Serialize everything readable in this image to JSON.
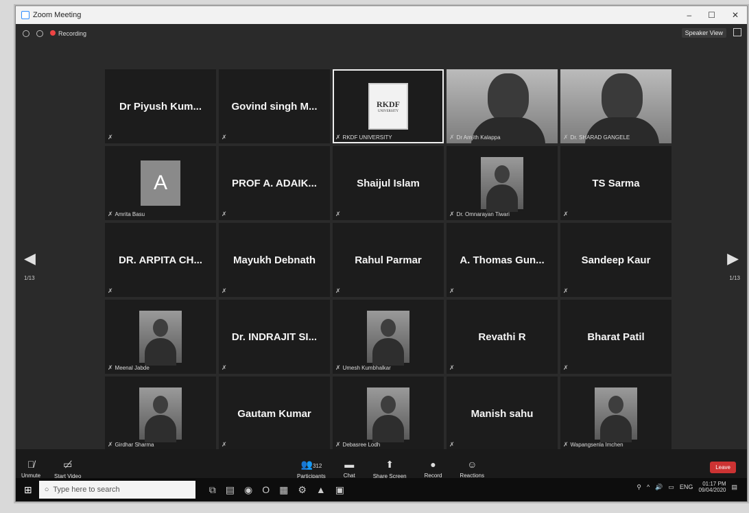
{
  "window": {
    "title": "Zoom Meeting",
    "controls": [
      "–",
      "☐",
      "✕"
    ]
  },
  "topbar": {
    "recording_label": "Recording",
    "speaker_view_label": "Speaker View"
  },
  "tiles": [
    {
      "name": "Dr Piyush  Kum...",
      "label": "",
      "type": "name"
    },
    {
      "name": "Govind singh M...",
      "label": "",
      "type": "name"
    },
    {
      "name": "",
      "label": "RKDF UNIVERSITY",
      "type": "rkdf",
      "logo_text": "RKDF",
      "logo_sub": "UNIVERSITY"
    },
    {
      "name": "",
      "label": "Dr Amjith Kalappa",
      "type": "video"
    },
    {
      "name": "",
      "label": "Dr. SHARAD GANGELE",
      "type": "video"
    },
    {
      "name": "",
      "label": "Amrita Basu",
      "type": "avatar",
      "initial": "A"
    },
    {
      "name": "PROF A. ADAIK...",
      "label": "",
      "type": "name"
    },
    {
      "name": "Shaijul Islam",
      "label": "",
      "type": "name"
    },
    {
      "name": "",
      "label": "Dr. Omnarayan Tiwari",
      "type": "photo"
    },
    {
      "name": "TS Sarma",
      "label": "",
      "type": "name"
    },
    {
      "name": "DR. ARPITA CH...",
      "label": "",
      "type": "name"
    },
    {
      "name": "Mayukh Debnath",
      "label": "",
      "type": "name"
    },
    {
      "name": "Rahul Parmar",
      "label": "",
      "type": "name"
    },
    {
      "name": "A. Thomas Gun...",
      "label": "",
      "type": "name"
    },
    {
      "name": "Sandeep Kaur",
      "label": "",
      "type": "name"
    },
    {
      "name": "",
      "label": "Meenal Jabde",
      "type": "photo"
    },
    {
      "name": "Dr. INDRAJIT SI...",
      "label": "",
      "type": "name"
    },
    {
      "name": "",
      "label": "Umesh Kumbhalkar",
      "type": "photo"
    },
    {
      "name": "Revathi R",
      "label": "",
      "type": "name"
    },
    {
      "name": "Bharat Patil",
      "label": "",
      "type": "name"
    },
    {
      "name": "",
      "label": "Girdhar Sharma",
      "type": "photo"
    },
    {
      "name": "Gautam Kumar",
      "label": "",
      "type": "name"
    },
    {
      "name": "",
      "label": "Debasree Lodh",
      "type": "photo"
    },
    {
      "name": "Manish sahu",
      "label": "",
      "type": "name"
    },
    {
      "name": "",
      "label": "Wapangsenla Imchen",
      "type": "photo"
    }
  ],
  "pagination": {
    "left_page": "1/13",
    "right_page": "1/13"
  },
  "toolbar": {
    "unmute": "Unmute",
    "start_video": "Start Video",
    "participants": "Participants",
    "participants_count": "312",
    "chat": "Chat",
    "share_screen": "Share Screen",
    "record": "Record",
    "reactions": "Reactions",
    "leave": "Leave"
  },
  "taskbar": {
    "search_placeholder": "Type here to search",
    "language": "ENG",
    "time": "01:17 PM",
    "date": "09/04/2020"
  }
}
